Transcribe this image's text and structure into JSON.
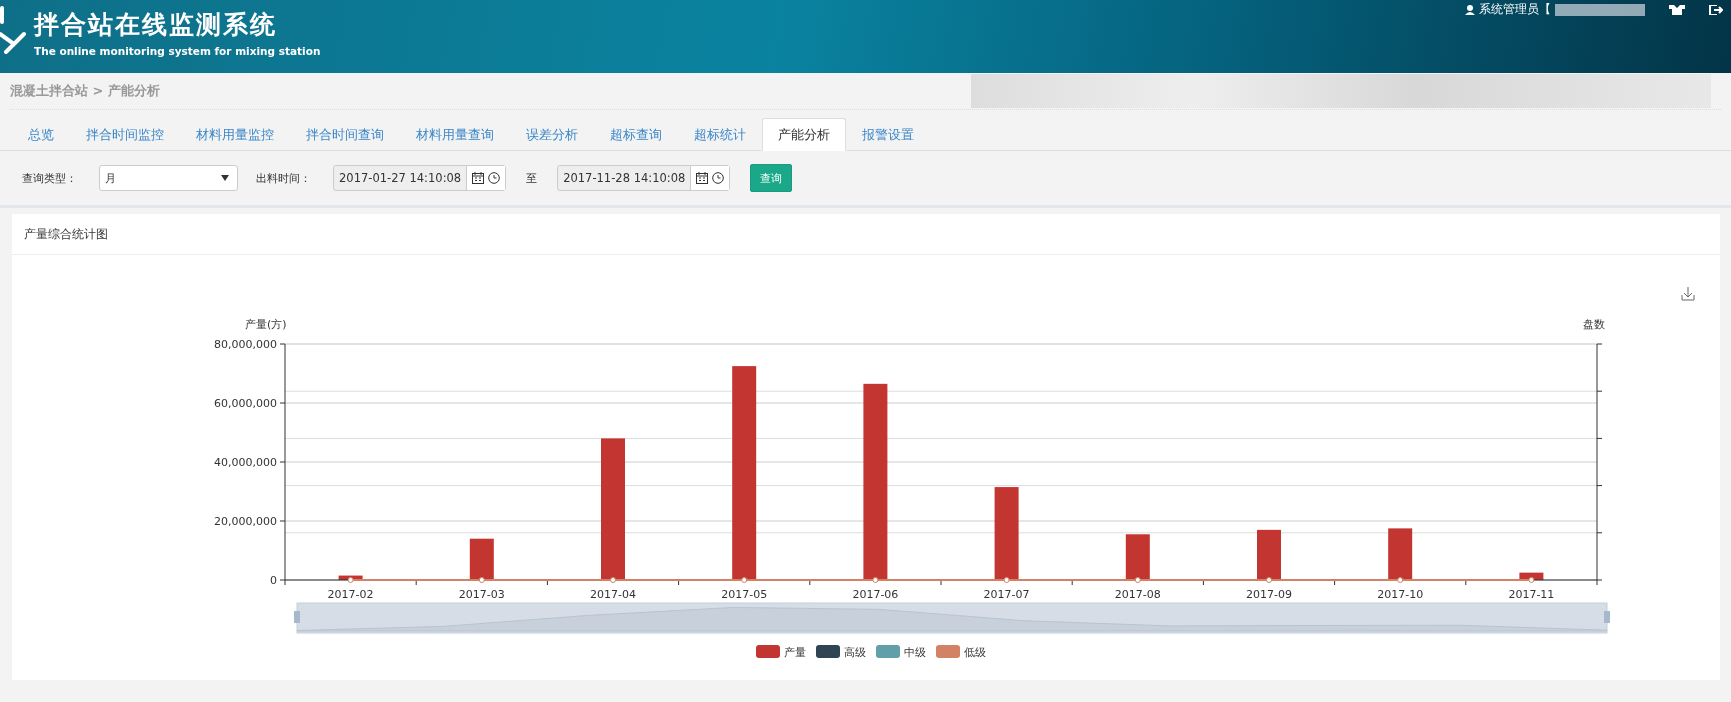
{
  "header": {
    "title": "拌合站在线监测系统",
    "subtitle": "The online monitoring system for mixing station",
    "user_label": "系统管理员【"
  },
  "breadcrumb": "混凝土拌合站 > 产能分析",
  "tabs": [
    {
      "label": "总览",
      "selected": false
    },
    {
      "label": "拌合时间监控",
      "selected": false
    },
    {
      "label": "材料用量监控",
      "selected": false
    },
    {
      "label": "拌合时间查询",
      "selected": false
    },
    {
      "label": "材料用量查询",
      "selected": false
    },
    {
      "label": "误差分析",
      "selected": false
    },
    {
      "label": "超标查询",
      "selected": false
    },
    {
      "label": "超标统计",
      "selected": false
    },
    {
      "label": "产能分析",
      "selected": true
    },
    {
      "label": "报警设置",
      "selected": false
    }
  ],
  "query": {
    "type_label": "查询类型：",
    "type_value": "月",
    "time_label": "出料时间：",
    "start": "2017-01-27 14:10:08",
    "to_label": "至",
    "end": "2017-11-28 14:10:08",
    "button": "查询"
  },
  "panel": {
    "title": "产量综合统计图",
    "chart_data": {
      "type": "bar",
      "grid": true,
      "ylabel": "产量(方)",
      "y2label": "盘数",
      "categories": [
        "2017-02",
        "2017-03",
        "2017-04",
        "2017-05",
        "2017-06",
        "2017-07",
        "2017-08",
        "2017-09",
        "2017-10",
        "2017-11"
      ],
      "ylim": [
        0,
        80000000
      ],
      "yticks": [
        {
          "value": 0,
          "label": "0"
        },
        {
          "value": 20000000,
          "label": "20,000,000"
        },
        {
          "value": 40000000,
          "label": "40,000,000"
        },
        {
          "value": 60000000,
          "label": "60,000,000"
        },
        {
          "value": 80000000,
          "label": "80,000,000"
        }
      ],
      "series": [
        {
          "name": "产量",
          "color": "#c23531",
          "values": [
            1500000,
            14000000,
            48000000,
            72500000,
            66500000,
            31500000,
            15500000,
            17000000,
            17500000,
            2500000
          ]
        },
        {
          "name": "高级",
          "color": "#2f4554",
          "values": [
            0,
            0,
            0,
            0,
            0,
            0,
            0,
            0,
            0,
            0
          ]
        },
        {
          "name": "中级",
          "color": "#61a0a8",
          "values": [
            0,
            0,
            0,
            0,
            0,
            0,
            0,
            0,
            0,
            0
          ]
        },
        {
          "name": "低级",
          "color": "#d48265",
          "values": [
            0,
            0,
            0,
            0,
            0,
            0,
            0,
            0,
            0,
            0
          ]
        }
      ]
    }
  }
}
